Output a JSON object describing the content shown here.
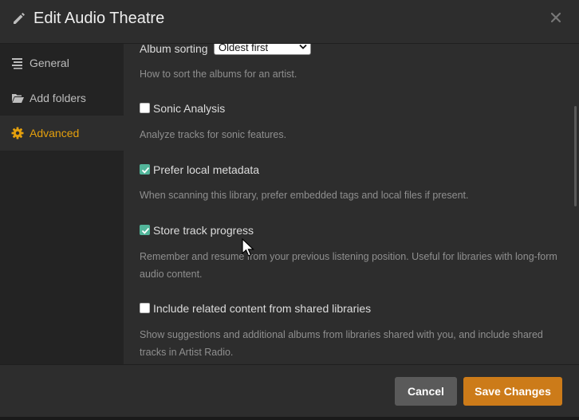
{
  "dialog": {
    "title": "Edit Audio Theatre",
    "title_icon": "pencil-icon",
    "close_icon": "close-icon"
  },
  "sidebar": {
    "items": [
      {
        "label": "General",
        "icon": "list-icon",
        "active": false
      },
      {
        "label": "Add folders",
        "icon": "folder-open-icon",
        "active": false
      },
      {
        "label": "Advanced",
        "icon": "gear-icon",
        "active": true
      }
    ],
    "active_color": "#e5a00d"
  },
  "settings": {
    "album_sorting": {
      "label": "Album sorting",
      "value": "Oldest first",
      "help": "How to sort the albums for an artist."
    },
    "sonic_analysis": {
      "label": "Sonic Analysis",
      "checked": false,
      "help": "Analyze tracks for sonic features."
    },
    "prefer_local_metadata": {
      "label": "Prefer local metadata",
      "checked": true,
      "help": "When scanning this library, prefer embedded tags and local files if present."
    },
    "store_track_progress": {
      "label": "Store track progress",
      "checked": true,
      "help": "Remember and resume from your previous listening position. Useful for libraries with long-form audio content."
    },
    "include_related_content": {
      "label": "Include related content from shared libraries",
      "checked": false,
      "help": "Show suggestions and additional albums from libraries shared with you, and include shared tracks in Artist Radio."
    }
  },
  "footer": {
    "cancel_label": "Cancel",
    "save_label": "Save Changes",
    "save_color": "#cc7b19",
    "check_color": "#52b59a"
  }
}
